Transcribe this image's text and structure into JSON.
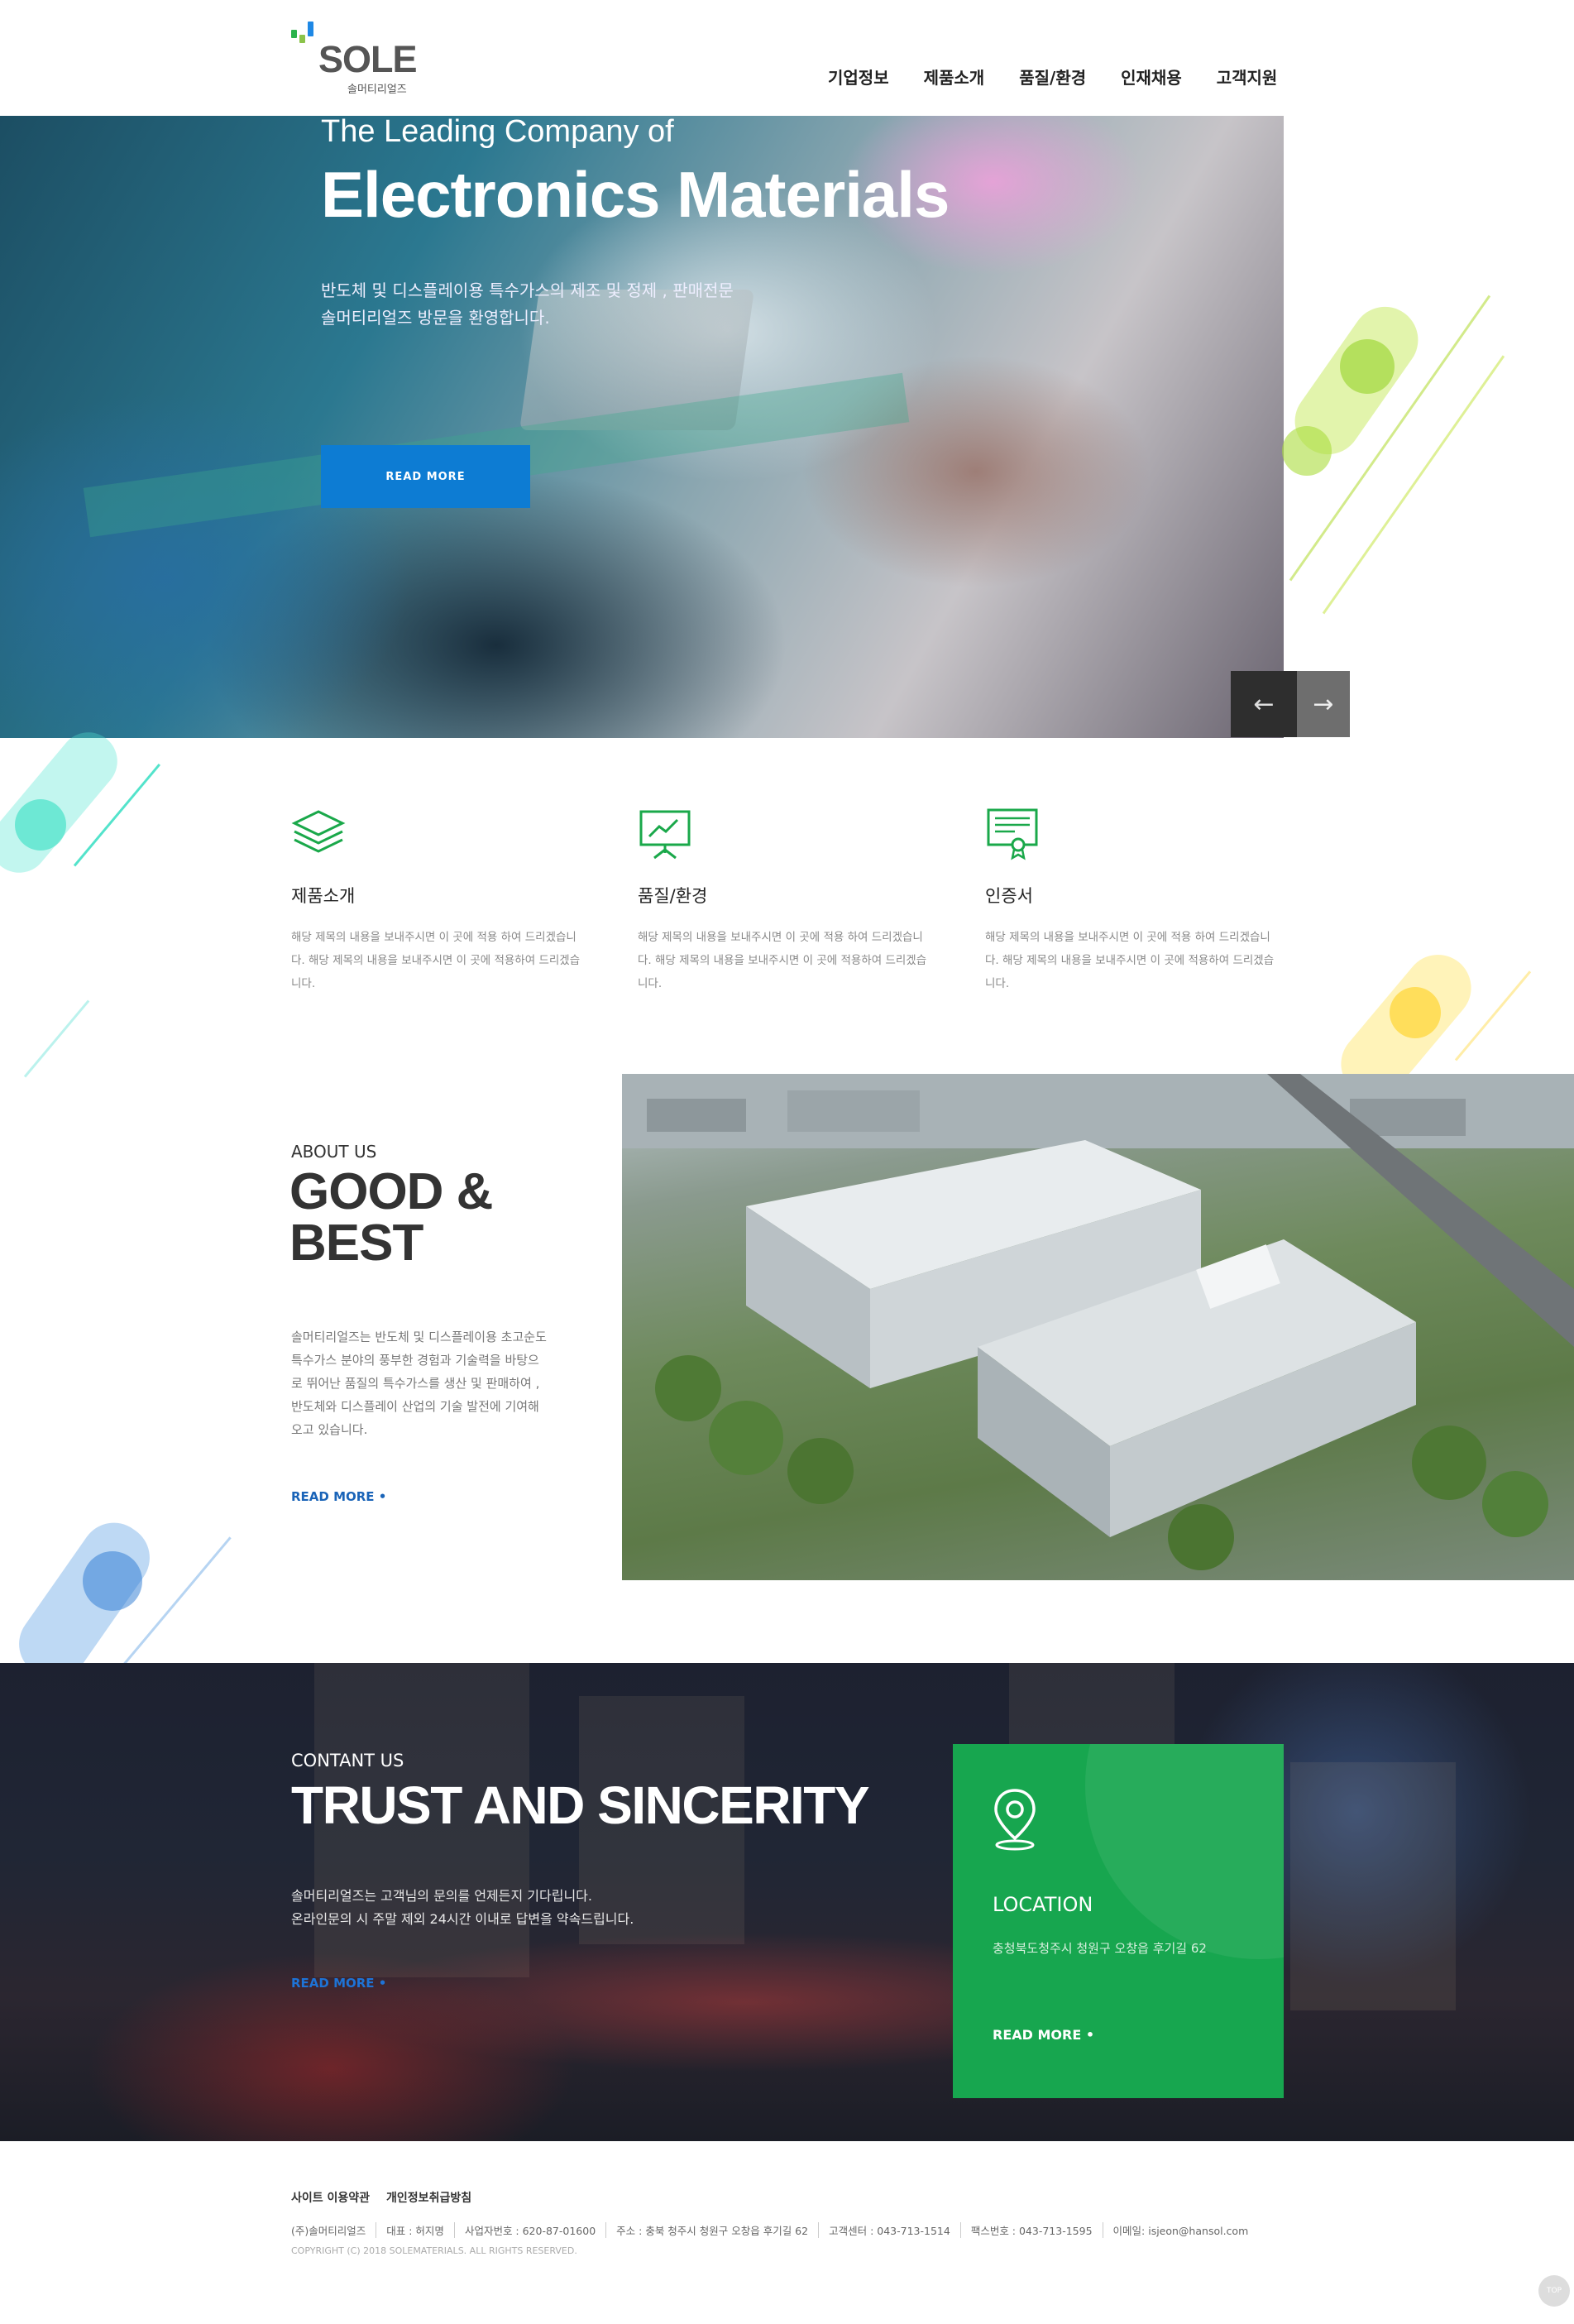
{
  "brand": {
    "name": "SOLE",
    "korean_name": "솔머티리얼즈"
  },
  "nav": {
    "items": [
      "기업정보",
      "제품소개",
      "품질/환경",
      "인재채용",
      "고객지원"
    ]
  },
  "hero": {
    "subtitle": "The Leading Company of",
    "title": "Electronics Materials",
    "desc_line1": "반도체 및 디스플레이용 특수가스의 제조 및 정제 , 판매전문",
    "desc_line2": "솔머티리얼즈 방문을 환영합니다.",
    "button": "READ MORE",
    "prev_arrow": "←",
    "next_arrow": "→"
  },
  "features": [
    {
      "title": "제품소개",
      "icon": "layers-icon",
      "text": "해당 제목의 내용을 보내주시면 이 곳에 적용 하여 드리겠습니다. 해당 제목의 내용을 보내주시면 이 곳에 적용하여 드리겠습니다."
    },
    {
      "title": "품질/환경",
      "icon": "presentation-chart-icon",
      "text": "해당 제목의 내용을 보내주시면 이 곳에 적용 하여 드리겠습니다. 해당 제목의 내용을 보내주시면 이 곳에 적용하여 드리겠습니다."
    },
    {
      "title": "인증서",
      "icon": "certificate-icon",
      "text": "해당 제목의 내용을 보내주시면 이 곳에 적용 하여 드리겠습니다. 해당 제목의 내용을 보내주시면 이 곳에 적용하여 드리겠습니다."
    }
  ],
  "about": {
    "eyebrow": "ABOUT US",
    "title": "GOOD & BEST",
    "text": "솔머티리얼즈는 반도체 및 디스플레이용 초고순도 특수가스 분야의 풍부한 경험과 기술력을 바탕으로 뛰어난 품질의 특수가스를 생산 및 판매하여 , 반도체와 디스플레이 산업의 기술 발전에 기여해 오고 있습니다.",
    "link": "READ MORE •"
  },
  "contact": {
    "eyebrow": "CONTANT US",
    "title": "TRUST AND SINCERITY",
    "text_line1": "솔머티리얼즈는 고객님의 문의를 언제든지 기다립니다.",
    "text_line2": "온라인문의 시 주말 제외 24시간 이내로 답변을 약속드립니다.",
    "link": "READ MORE •"
  },
  "location": {
    "title": "LOCATION",
    "address": "충청북도청주시 청원구 오창읍 후기길 62",
    "link": "READ MORE •"
  },
  "footer": {
    "links": [
      "사이트 이용약관",
      "개인정보취급방침"
    ],
    "info": [
      "(주)솔머티리얼즈",
      "대표 : 허지명",
      "사업자번호 : 620-87-01600",
      "주소 : 충북 청주시 청원구 오창읍 후기길 62",
      "고객센터 : 043-713-1514",
      "팩스번호 : 043-713-1595",
      "이메일: isjeon@hansol.com"
    ],
    "copyright": "COPYRIGHT (C) 2018 SOLEMATERIALS. ALL RIGHTS RESERVED.",
    "top_button": "TOP"
  },
  "colors": {
    "accent_blue": "#0d7cd3",
    "accent_green": "#17a64f",
    "link_blue": "#1a64b8"
  }
}
